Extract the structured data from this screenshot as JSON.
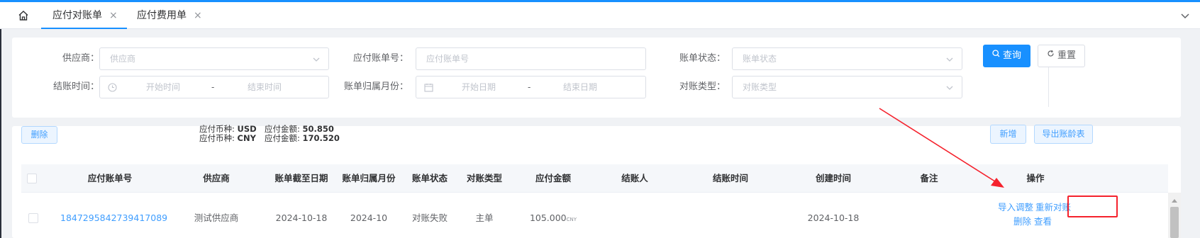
{
  "tabs": [
    {
      "label": "应付对账单",
      "close": "×"
    },
    {
      "label": "应付费用单",
      "close": "×"
    }
  ],
  "filters": {
    "supplier_label": "供应商：",
    "supplier_placeholder": "供应商",
    "bill_no_label": "应付账单号：",
    "bill_no_placeholder": "应付账单号",
    "status_label": "账单状态：",
    "status_placeholder": "账单状态",
    "settle_time_label": "结账时间：",
    "settle_start_placeholder": "开始时间",
    "settle_end_placeholder": "结束时间",
    "month_label": "账单归属月份：",
    "month_start_placeholder": "开始日期",
    "month_end_placeholder": "结束日期",
    "recon_type_label": "对账类型：",
    "recon_type_placeholder": "对账类型",
    "range_sep": "-"
  },
  "buttons": {
    "query": "查询",
    "reset": "重置",
    "delete": "删除",
    "add": "新增",
    "export": "导出账龄表"
  },
  "summary": [
    {
      "currency_label": "应付币种:",
      "currency": "USD",
      "amount_label": "应付金额:",
      "amount": "50.850"
    },
    {
      "currency_label": "应付币种:",
      "currency": "CNY",
      "amount_label": "应付金额:",
      "amount": "170.520"
    }
  ],
  "table": {
    "columns": [
      "应付账单号",
      "供应商",
      "账单截至日期",
      "账单归属月份",
      "账单状态",
      "对账类型",
      "应付金额",
      "结账人",
      "结账时间",
      "创建时间",
      "备注",
      "操作"
    ],
    "rows": [
      {
        "bill_no": "1847295842739417089",
        "supplier": "测试供应商",
        "due_date": "2024-10-18",
        "month": "2024-10",
        "status": "对账失败",
        "recon_type": "主单",
        "amount": "105.000",
        "amount_currency": "CNY",
        "settler": "",
        "settle_time": "",
        "created": "2024-10-18",
        "remark": "",
        "actions": [
          "导入调整",
          "重新对账",
          "删除",
          "查看"
        ]
      }
    ]
  },
  "colors": {
    "primary": "#1890ff",
    "link": "#409eff",
    "annotation": "#f5222d"
  }
}
